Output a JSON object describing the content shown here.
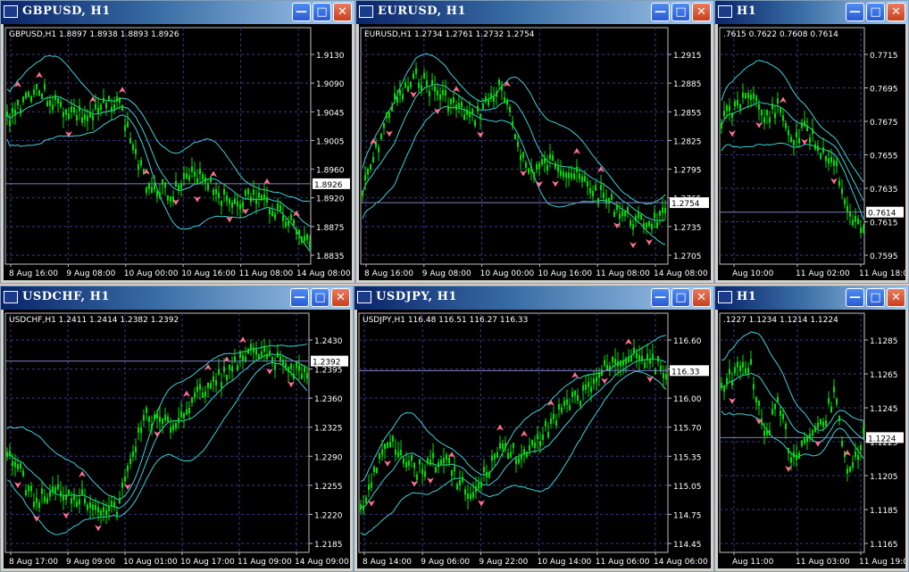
{
  "colors": {
    "background": "#000000",
    "grid": "#3a3a8a",
    "candles": "#00e000",
    "bands": "#40d0d8",
    "current_line": "#8080c0",
    "fractal": "#ff7090",
    "text": "#ffffff"
  },
  "icons": {
    "window_icon": "chart-window-icon",
    "minimize": "minimize-icon",
    "maximize": "maximize-icon",
    "close": "close-icon"
  },
  "windows": [
    {
      "title": "GBPUSD, H1",
      "chart_info": "GBPUSD,H1  1.8897 1.8938 1.8893 1.8926",
      "current_price": "1.8926",
      "price_labels": [
        "1.9130",
        "1.9090",
        "1.9045",
        "1.9005",
        "1.8960",
        "1.8920",
        "1.8875",
        "1.8835"
      ],
      "time_labels": [
        "8 Aug 16:00",
        "9 Aug 08:00",
        "10 Aug 00:00",
        "10 Aug 16:00",
        "11 Aug 08:00",
        "14 Aug 08:00"
      ]
    },
    {
      "title": "EURUSD, H1",
      "chart_info": "EURUSD,H1  1.2734 1.2761 1.2732 1.2754",
      "current_price": "1.2754",
      "price_labels": [
        "1.2915",
        "1.2885",
        "1.2855",
        "1.2825",
        "1.2795",
        "1.2765",
        "1.2735",
        "1.2705"
      ],
      "time_labels": [
        "8 Aug 16:00",
        "9 Aug 08:00",
        "10 Aug 00:00",
        "10 Aug 16:00",
        "11 Aug 08:00",
        "14 Aug 08:00"
      ]
    },
    {
      "title": "H1",
      "chart_info": ".7615 0.7622 0.7608 0.7614",
      "current_price": "0.7614",
      "price_labels": [
        "0.7715",
        "0.7695",
        "0.7675",
        "0.7655",
        "0.7635",
        "0.7615",
        "0.7595"
      ],
      "time_labels": [
        "Aug 10:00",
        "11 Aug 02:00",
        "11 Aug 18:00"
      ]
    },
    {
      "title": "USDCHF, H1",
      "chart_info": "USDCHF,H1  1.2411 1.2414 1.2382 1.2392",
      "current_price": "1.2392",
      "price_labels": [
        "1.2430",
        "1.2395",
        "1.2360",
        "1.2325",
        "1.2290",
        "1.2255",
        "1.2220",
        "1.2185"
      ],
      "time_labels": [
        "8 Aug 17:00",
        "9 Aug 09:00",
        "10 Aug 01:00",
        "10 Aug 17:00",
        "11 Aug 09:00",
        "14 Aug 09:00"
      ]
    },
    {
      "title": "USDJPY, H1",
      "chart_info": "USDJPY,H1  116.48 116.51 116.27 116.33",
      "current_price": "116.33",
      "price_labels": [
        "116.60",
        "116.30",
        "116.00",
        "115.70",
        "115.35",
        "115.05",
        "114.75",
        "114.45"
      ],
      "time_labels": [
        "8 Aug 14:00",
        "9 Aug 06:00",
        "9 Aug 22:00",
        "10 Aug 14:00",
        "11 Aug 06:00",
        "14 Aug 06:00"
      ]
    },
    {
      "title": "H1",
      "chart_info": ".1227 1.1234 1.1214 1.1224",
      "current_price": "1.1224",
      "price_labels": [
        "1.1285",
        "1.1265",
        "1.1245",
        "1.1225",
        "1.1205",
        "1.1185",
        "1.1165"
      ],
      "time_labels": [
        "Aug 11:00",
        "11 Aug 03:00",
        "11 Aug 19:00"
      ]
    }
  ]
}
